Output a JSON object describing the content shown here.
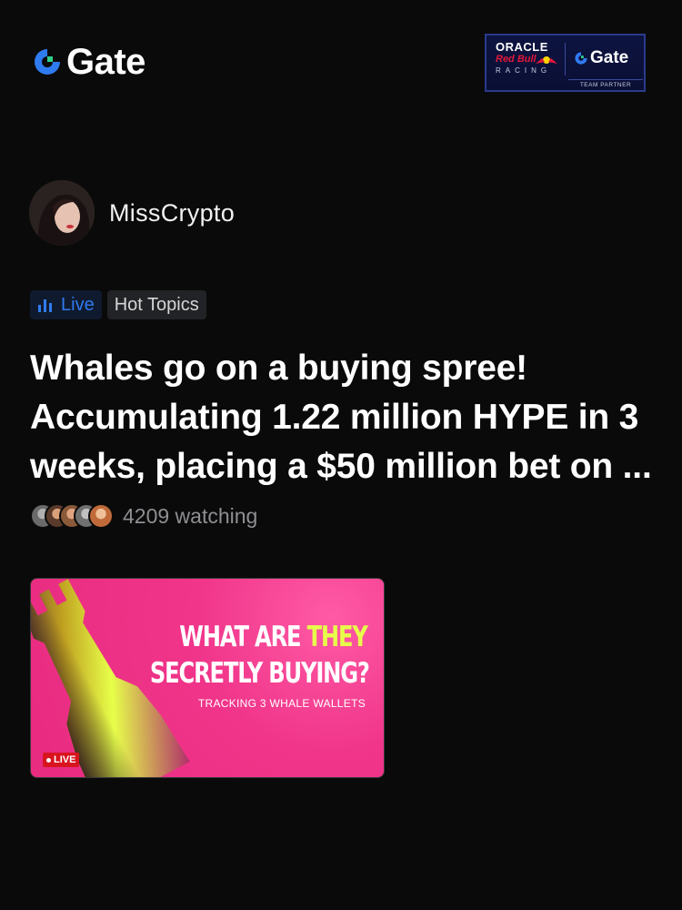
{
  "brand": {
    "name": "Gate",
    "logo_icon": "gate-logo-icon",
    "accent": "#2f7bf0"
  },
  "partner": {
    "oracle": "ORACLE",
    "redbull": "Red Bull",
    "racing": "RACING",
    "gate": "Gate",
    "team_partner": "TEAM PARTNER"
  },
  "author": {
    "name": "MissCrypto"
  },
  "tags": {
    "live": "Live",
    "hot": "Hot Topics"
  },
  "post": {
    "title": "Whales go on a buying spree! Accumulating 1.22 million HYPE in 3 weeks, placing a $50 million bet on ..."
  },
  "watching": {
    "text": "4209 watching"
  },
  "thumbnail": {
    "line1_prefix": "WHAT ARE ",
    "line1_highlight": "THEY",
    "line2": "SECRETLY BUYING?",
    "subtitle": "TRACKING 3 WHALE WALLETS",
    "live_badge": "LIVE"
  }
}
